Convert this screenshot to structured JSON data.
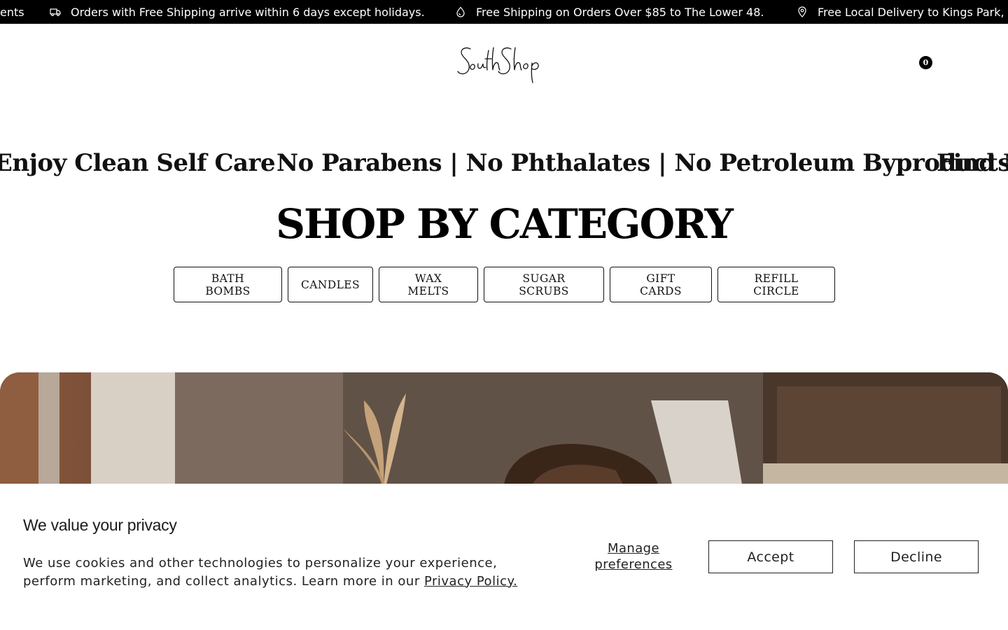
{
  "announcement": {
    "items": [
      {
        "icon": "none",
        "text": "ents"
      },
      {
        "icon": "truck-icon",
        "text": "Orders with Free Shipping arrive within 6 days except holidays."
      },
      {
        "icon": "drop-icon",
        "text": "Free Shipping on Orders Over $85 to The Lower 48."
      },
      {
        "icon": "map-pin-icon",
        "text": "Free Local Delivery to Kings Park,"
      }
    ]
  },
  "header": {
    "logo_text": "SouthShop",
    "cart_count": "0"
  },
  "marquee": {
    "items": [
      "Enjoy Clean Self Care",
      "No Parabens | No Phthalates | No Petroleum Byproducts",
      "Find M"
    ]
  },
  "categories": {
    "title": "SHOP BY CATEGORY",
    "buttons": [
      "BATH BOMBS",
      "CANDLES",
      "WAX MELTS",
      "SUGAR SCRUBS",
      "GIFT CARDS",
      "REFILL CIRCLE"
    ]
  },
  "cookie": {
    "title": "We value your privacy",
    "text_before_link": "We use cookies and other technologies to personalize your experience, perform marketing, and collect analytics. Learn more in our ",
    "link_text": "Privacy Policy.",
    "manage_label": "Manage preferences",
    "accept_label": "Accept",
    "decline_label": "Decline"
  }
}
